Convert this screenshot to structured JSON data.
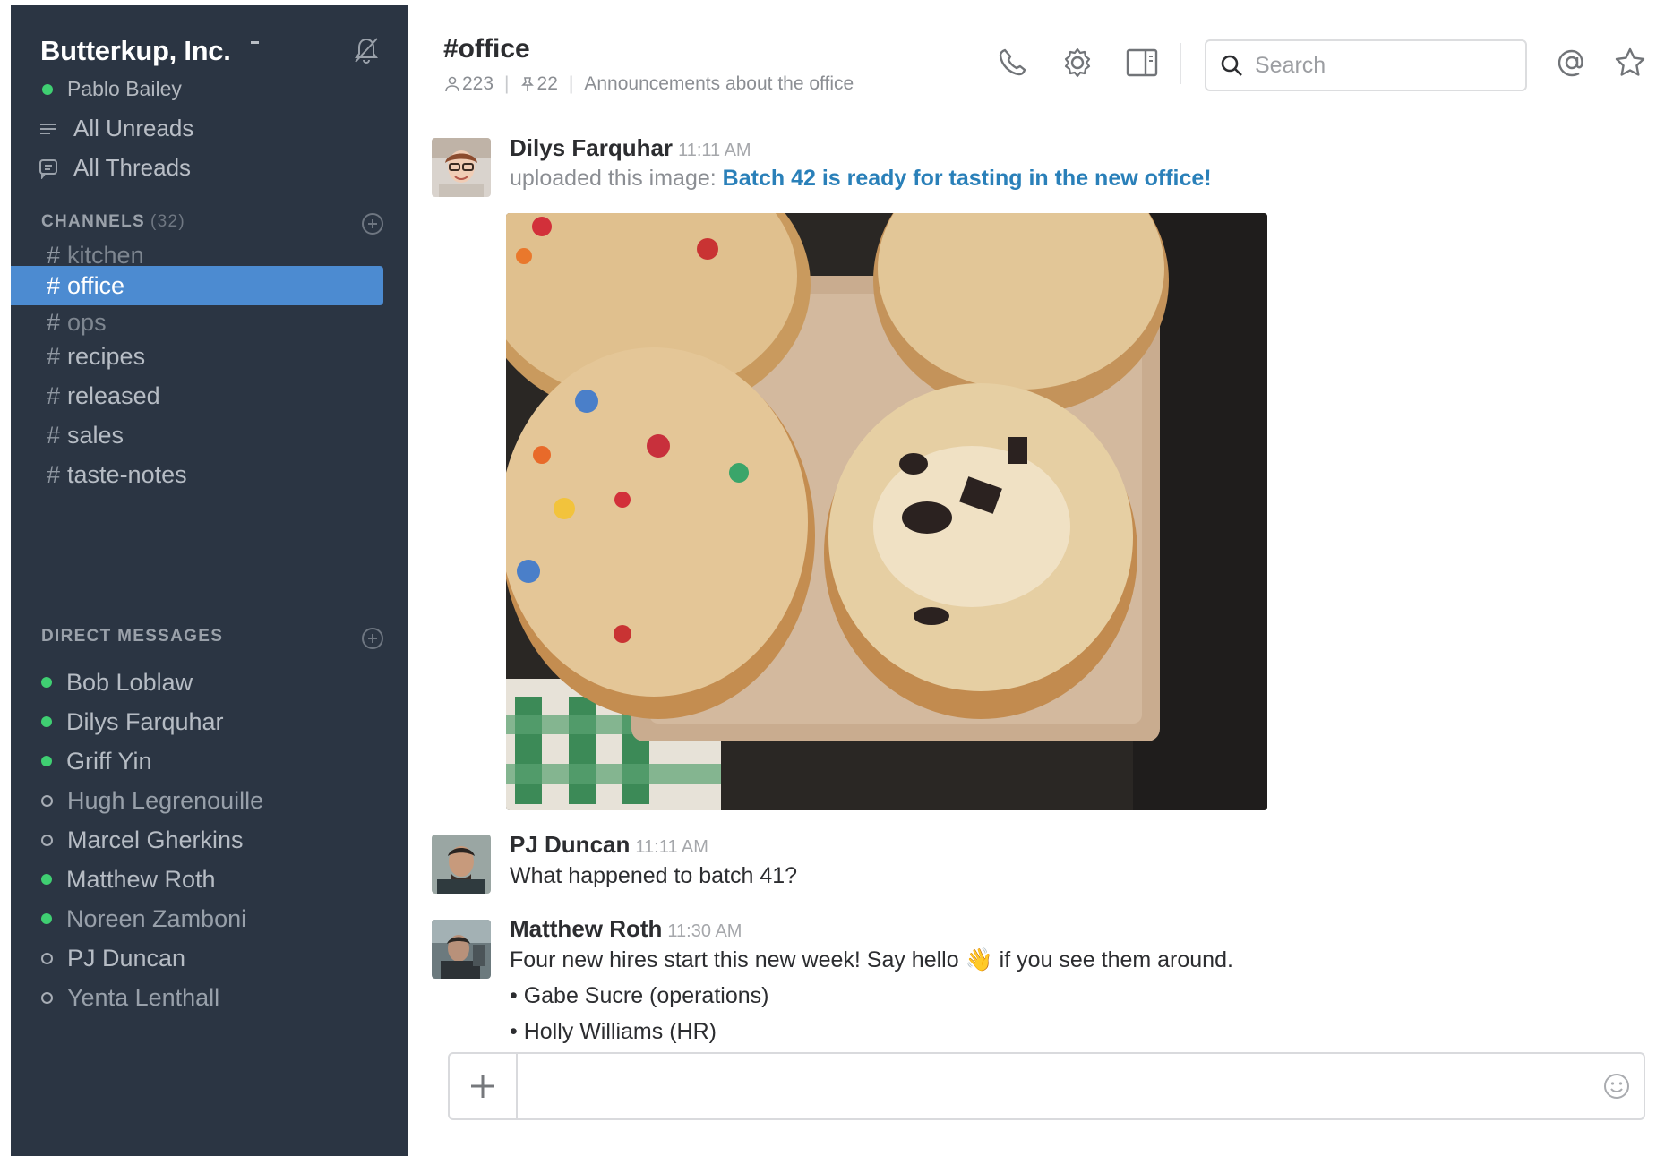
{
  "sidebar": {
    "team_name": "Butterkup, Inc.",
    "user_name": "Pablo Bailey",
    "nav": [
      {
        "label": "All Unreads",
        "icon": "unreads-icon"
      },
      {
        "label": "All Threads",
        "icon": "threads-icon"
      }
    ],
    "channels_title": "CHANNELS",
    "channels_count": "(32)",
    "channels": [
      {
        "name": "kitchen",
        "active": false
      },
      {
        "name": "office",
        "active": true
      },
      {
        "name": "ops",
        "active": false
      },
      {
        "name": "recipes",
        "active": false
      },
      {
        "name": "released",
        "active": false
      },
      {
        "name": "sales",
        "active": false
      },
      {
        "name": "taste-notes",
        "active": false
      }
    ],
    "dm_title": "DIRECT MESSAGES",
    "direct_messages": [
      {
        "name": "Bob Loblaw",
        "status": "online"
      },
      {
        "name": "Dilys Farquhar",
        "status": "online"
      },
      {
        "name": "Griff Yin",
        "status": "online"
      },
      {
        "name": "Hugh Legrenouille",
        "status": "away"
      },
      {
        "name": "Marcel Gherkins",
        "status": "away"
      },
      {
        "name": "Matthew Roth",
        "status": "online"
      },
      {
        "name": "Noreen Zamboni",
        "status": "online"
      },
      {
        "name": "PJ Duncan",
        "status": "away"
      },
      {
        "name": "Yenta Lenthall",
        "status": "away"
      }
    ]
  },
  "header": {
    "channel_title": "#office",
    "member_count": "223",
    "pinned_count": "22",
    "purpose": "Announcements about the office",
    "search_placeholder": "Search"
  },
  "messages": [
    {
      "author": "Dilys Farquhar",
      "time": "11:11 AM",
      "prefix": "uploaded this image:",
      "link": "Batch 42 is ready for tasting in the new office!"
    },
    {
      "author": "PJ Duncan",
      "time": "11:11 AM",
      "text": "What happened to batch 41?"
    },
    {
      "author": "Matthew Roth",
      "time": "11:30 AM",
      "text_before": "Four new hires start this new week! Say hello",
      "emoji": "👋",
      "text_after": "if you see them around.",
      "bullets": [
        "Gabe Sucre (operations)",
        "Holly Williams (HR)"
      ]
    }
  ],
  "composer": {
    "placeholder": ""
  },
  "colors": {
    "sidebar_bg": "#2b3543",
    "active_channel": "#4c8bd1",
    "online_dot": "#3fcf72",
    "link": "#2a80b9"
  }
}
